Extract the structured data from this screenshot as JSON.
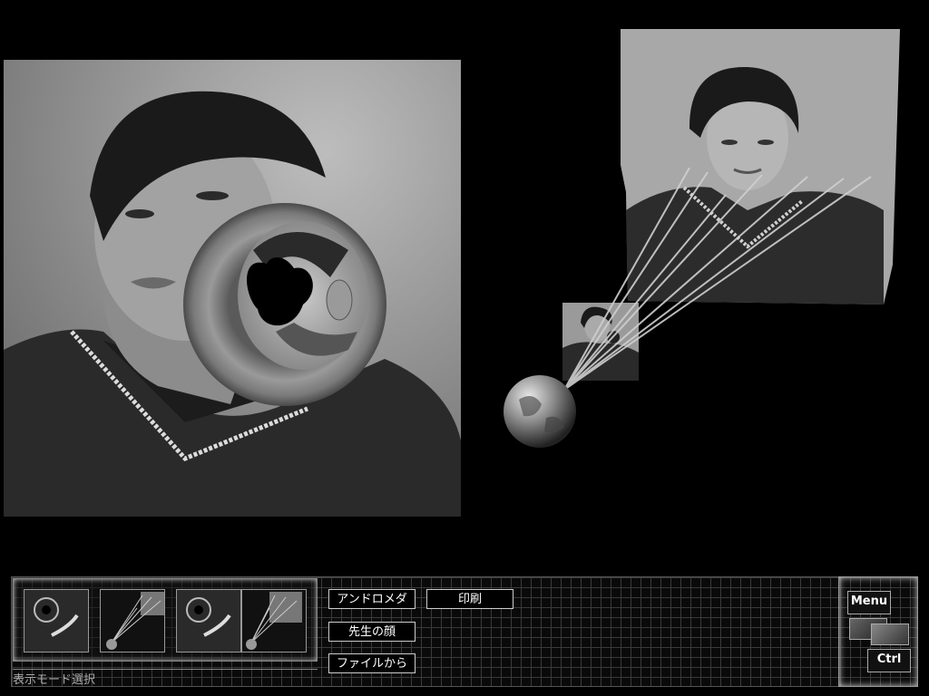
{
  "images": {
    "main": "lensed-portrait-photo",
    "side": "source-portrait-photo",
    "mini": "projected-portrait-photo",
    "globe": "globe-lens-object"
  },
  "mode_select": {
    "caption": "表示モード選択",
    "thumbnails": [
      "lens-view-thumbnail",
      "ray-view-thumbnail",
      "lens-view-thumbnail",
      "ray-view-thumbnail"
    ]
  },
  "buttons": {
    "andromeda": "アンドロメダ",
    "teacher_face": "先生の顔",
    "from_file": "ファイルから",
    "print": "印刷"
  },
  "menu": {
    "menu_label": "Menu",
    "ctrl_label": "Ctrl"
  }
}
